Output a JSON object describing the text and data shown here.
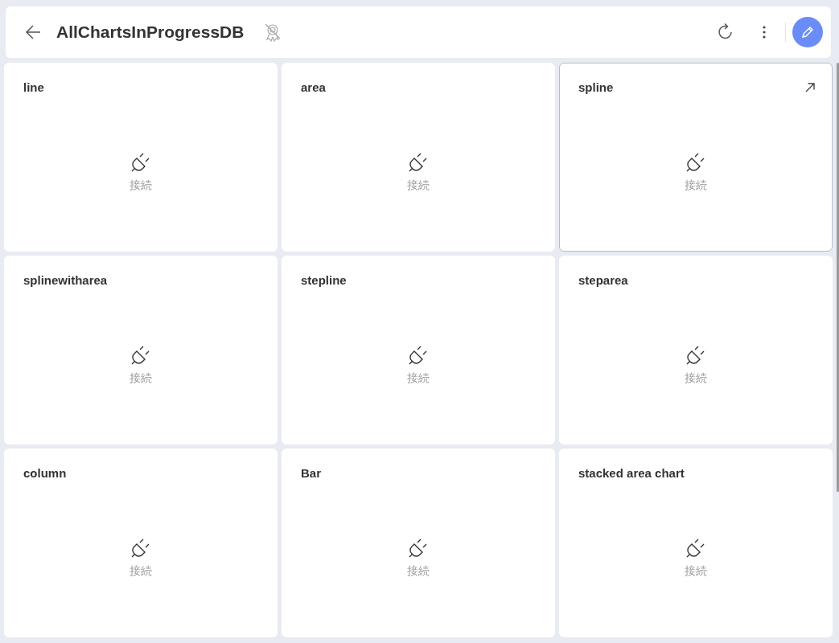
{
  "header": {
    "title": "AllChartsInProgressDB"
  },
  "cards": [
    {
      "title": "line",
      "connect_label": "接続",
      "hovered": false
    },
    {
      "title": "area",
      "connect_label": "接続",
      "hovered": false
    },
    {
      "title": "spline",
      "connect_label": "接続",
      "hovered": true
    },
    {
      "title": "splinewitharea",
      "connect_label": "接続",
      "hovered": false
    },
    {
      "title": "stepline",
      "connect_label": "接続",
      "hovered": false
    },
    {
      "title": "steparea",
      "connect_label": "接続",
      "hovered": false
    },
    {
      "title": "column",
      "connect_label": "接続",
      "hovered": false
    },
    {
      "title": "Bar",
      "connect_label": "接続",
      "hovered": false
    },
    {
      "title": "stacked area chart",
      "connect_label": "接続",
      "hovered": false
    }
  ]
}
